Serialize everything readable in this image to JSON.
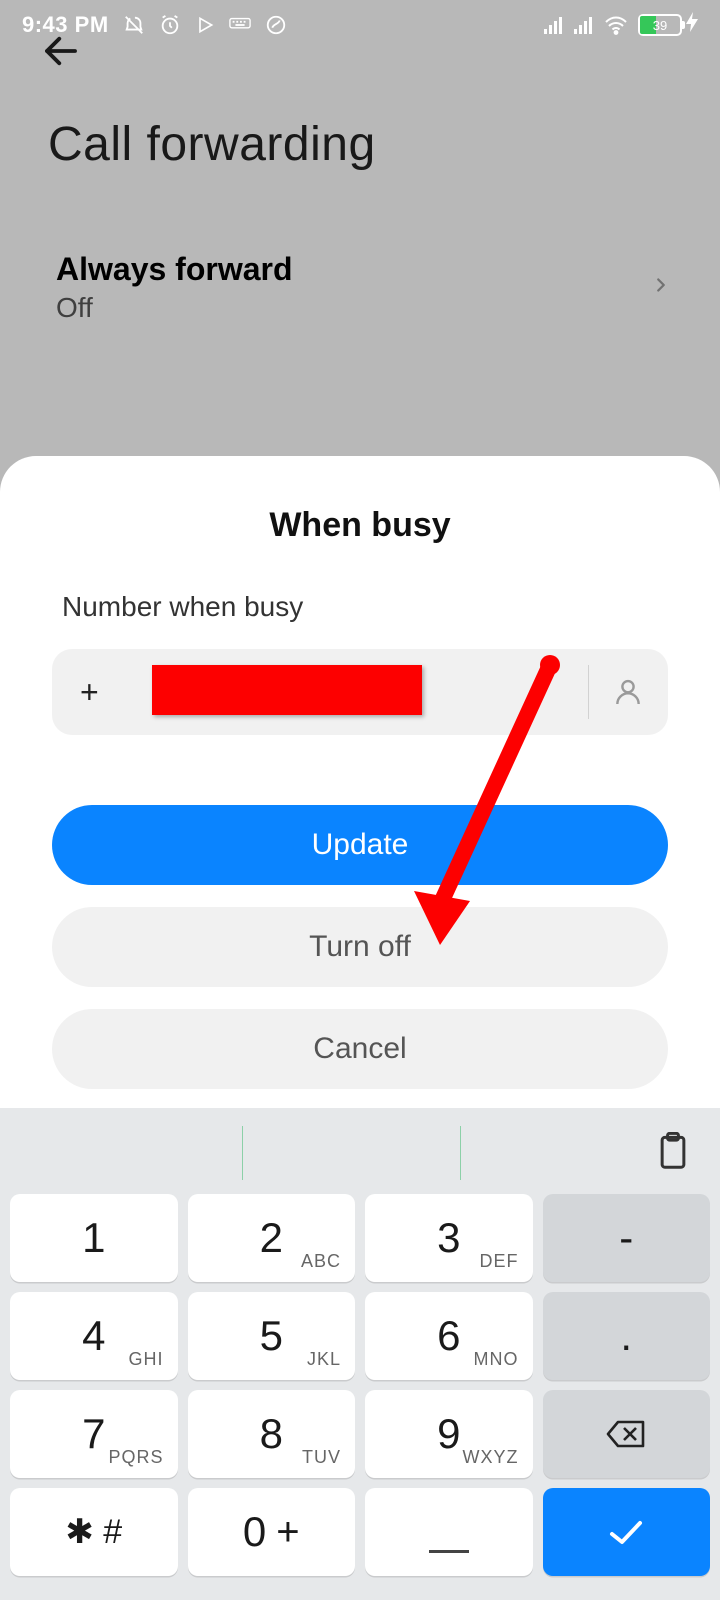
{
  "status": {
    "time": "9:43 PM",
    "battery_pct": "39"
  },
  "page": {
    "title": "Call forwarding",
    "always_forward": {
      "label": "Always forward",
      "value": "Off"
    }
  },
  "sheet": {
    "title": "When busy",
    "field_label": "Number when busy",
    "field_prefix": "+",
    "update": "Update",
    "turn_off": "Turn off",
    "cancel": "Cancel"
  },
  "keypad": {
    "k1": {
      "n": "1",
      "s": ""
    },
    "k2": {
      "n": "2",
      "s": "ABC"
    },
    "k3": {
      "n": "3",
      "s": "DEF"
    },
    "kdash": {
      "n": "-"
    },
    "k4": {
      "n": "4",
      "s": "GHI"
    },
    "k5": {
      "n": "5",
      "s": "JKL"
    },
    "k6": {
      "n": "6",
      "s": "MNO"
    },
    "kdot": {
      "n": "."
    },
    "k7": {
      "n": "7",
      "s": "PQRS"
    },
    "k8": {
      "n": "8",
      "s": "TUV"
    },
    "k9": {
      "n": "9",
      "s": "WXYZ"
    },
    "kstar": {
      "n": "✱ #"
    },
    "k0": {
      "n": "0",
      "plus": "+"
    }
  }
}
